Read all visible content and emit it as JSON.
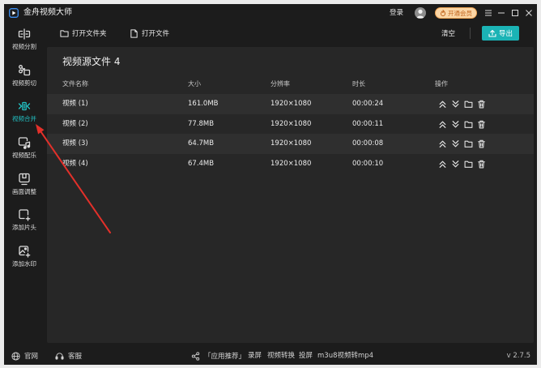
{
  "app": {
    "title": "金舟视频大师",
    "logo_icon": "app-logo-icon"
  },
  "titlebar": {
    "login_label": "登录",
    "avatar_icon": "user-avatar-icon",
    "vip_label": "开通会员",
    "vip_icon": "vip-flame-icon",
    "window_controls": [
      "menu-icon",
      "minimize-icon",
      "maximize-icon",
      "close-icon"
    ]
  },
  "sidebar": {
    "items": [
      {
        "label": "视频分割",
        "icon": "split-icon",
        "active": false
      },
      {
        "label": "视频剪切",
        "icon": "cut-icon",
        "active": false
      },
      {
        "label": "视频合并",
        "icon": "merge-icon",
        "active": true
      },
      {
        "label": "视频配乐",
        "icon": "music-icon",
        "active": false
      },
      {
        "label": "画面调整",
        "icon": "adjust-icon",
        "active": false
      },
      {
        "label": "添加片头",
        "icon": "add-intro-icon",
        "active": false
      },
      {
        "label": "添加水印",
        "icon": "add-watermark-icon",
        "active": false
      }
    ]
  },
  "toolbar": {
    "open_folder": {
      "label": "打开文件夹",
      "icon": "folder-icon"
    },
    "open_file": {
      "label": "打开文件",
      "icon": "file-icon"
    },
    "clear_label": "清空",
    "export": {
      "label": "导出",
      "icon": "export-icon"
    }
  },
  "file_list": {
    "title": "视频源文件",
    "count": 4,
    "columns": [
      "文件名称",
      "大小",
      "分辨率",
      "时长",
      "操作"
    ],
    "rows": [
      {
        "name": "视频 (1)",
        "size": "161.0MB",
        "resolution": "1920×1080",
        "duration": "00:00:24"
      },
      {
        "name": "视频 (2)",
        "size": "77.8MB",
        "resolution": "1920×1080",
        "duration": "00:00:11"
      },
      {
        "name": "视频 (3)",
        "size": "64.7MB",
        "resolution": "1920×1080",
        "duration": "00:00:08"
      },
      {
        "name": "视频 (4)",
        "size": "67.4MB",
        "resolution": "1920×1080",
        "duration": "00:00:10"
      }
    ],
    "row_action_icons": [
      "move-up-icon",
      "move-down-icon",
      "open-folder-icon",
      "delete-icon"
    ]
  },
  "footer": {
    "website": {
      "label": "官网",
      "icon": "globe-icon"
    },
    "support": {
      "label": "客服",
      "icon": "headset-icon"
    },
    "recommend": {
      "label": "「应用推荐」",
      "icon": "recommend-icon"
    },
    "links": [
      "录屏",
      "视频转换",
      "投屏",
      "m3u8视频转mp4"
    ],
    "version": "v 2.7.5"
  },
  "colors": {
    "accent": "#22c1c3",
    "export_button": "#1bb3b5",
    "vip_background": "#fbd6a6",
    "vip_text": "#c0621a",
    "window_background": "#1c1c1c",
    "panel_background": "#272727",
    "row_stripe": "#2f2f2f",
    "annotation": "#e3302a"
  }
}
